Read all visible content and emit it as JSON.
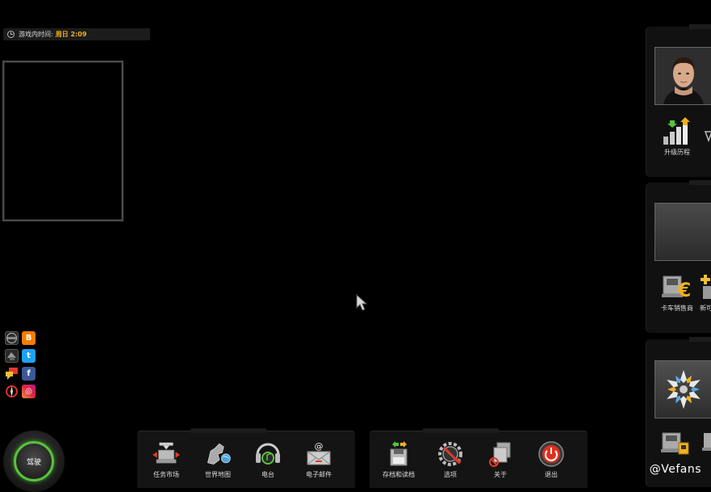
{
  "game_time": {
    "label": "游戏内时间:",
    "value": "周日 2:09"
  },
  "social": {
    "blogger_glyph": "B",
    "twitter_glyph": "t",
    "facebook_glyph": "f",
    "instagram_glyph": "◎"
  },
  "drive_button": {
    "label": "驾驶",
    "ring_color": "#58c23c"
  },
  "bottom_menu_left": [
    {
      "label": "任务市场",
      "icon": "freight-market-icon"
    },
    {
      "label": "世界地图",
      "icon": "world-map-icon"
    },
    {
      "label": "电台",
      "icon": "radio-icon"
    },
    {
      "label": "电子邮件",
      "icon": "email-icon"
    }
  ],
  "bottom_menu_right": [
    {
      "label": "存档和读档",
      "icon": "save-load-icon"
    },
    {
      "label": "选项",
      "icon": "options-icon"
    },
    {
      "label": "关于",
      "icon": "about-icon"
    },
    {
      "label": "退出",
      "icon": "exit-icon"
    }
  ],
  "right_panels": {
    "profile": {
      "skills_label": "升级历程"
    },
    "company": {
      "dealer_label": "卡车销售商",
      "truncated_label": "新可"
    }
  },
  "watermark": "@Vefans",
  "colors": {
    "accent_orange": "#f0b020",
    "drive_green": "#58c23c",
    "exit_red": "#e0301e"
  }
}
